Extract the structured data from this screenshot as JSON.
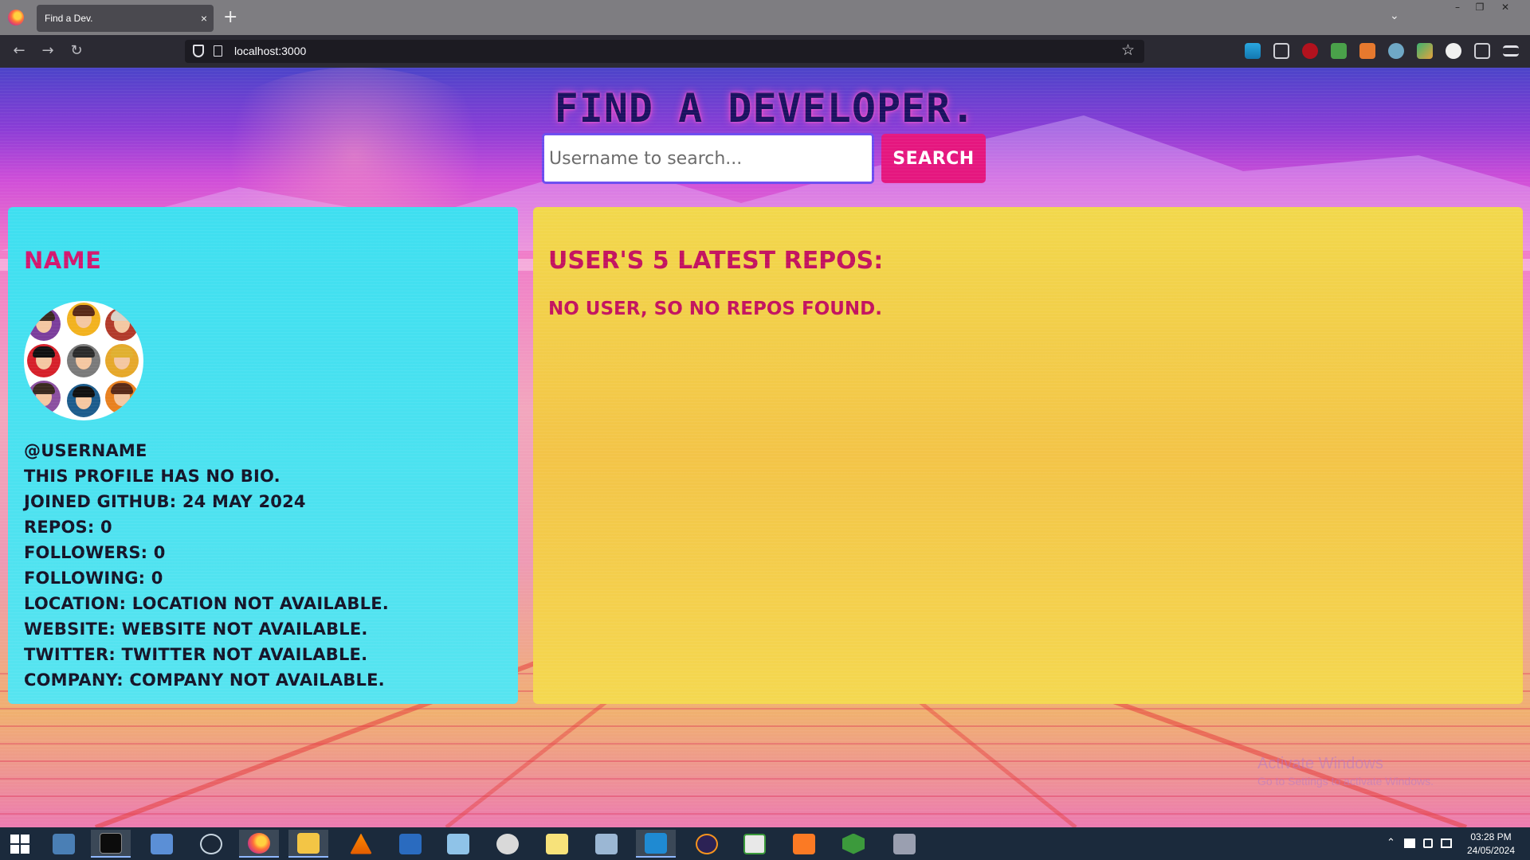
{
  "browser": {
    "tab_title": "Find a Dev.",
    "tab_close": "×",
    "new_tab": "+",
    "tab_list": "⌄",
    "window_controls": [
      "–",
      "❐",
      "✕"
    ],
    "nav": {
      "back": "←",
      "forward": "→",
      "reload": "↻"
    },
    "url": "localhost:3000",
    "bookmark_star": "☆"
  },
  "page": {
    "title": "Find a developer.",
    "search": {
      "placeholder": "Username to search...",
      "value": "",
      "button_label": "Search"
    },
    "profile": {
      "name": "Name",
      "username": "@username",
      "bio": "This profile has no bio.",
      "joined": "Joined GitHub: 24 May 2024",
      "repos": "Repos: 0",
      "followers": "Followers: 0",
      "following": "Following: 0",
      "location": "Location: Location not available.",
      "website": "Website: Website not available.",
      "twitter": "Twitter: Twitter not available.",
      "company": "Company: Company not available."
    },
    "repos": {
      "heading": "User's 5 latest repos:",
      "empty_message": "No user, so no repos found."
    },
    "watermark": {
      "title": "Activate Windows",
      "subtitle": "Go to Settings to activate Windows."
    }
  },
  "taskbar": {
    "clock_time": "03:28 PM",
    "clock_date": "24/05/2024",
    "tray_arrow": "⌃",
    "colors": {
      "accent": "#e5177f",
      "profile_card": "#4fe1f0",
      "repo_card": "#f3cf4b"
    }
  }
}
